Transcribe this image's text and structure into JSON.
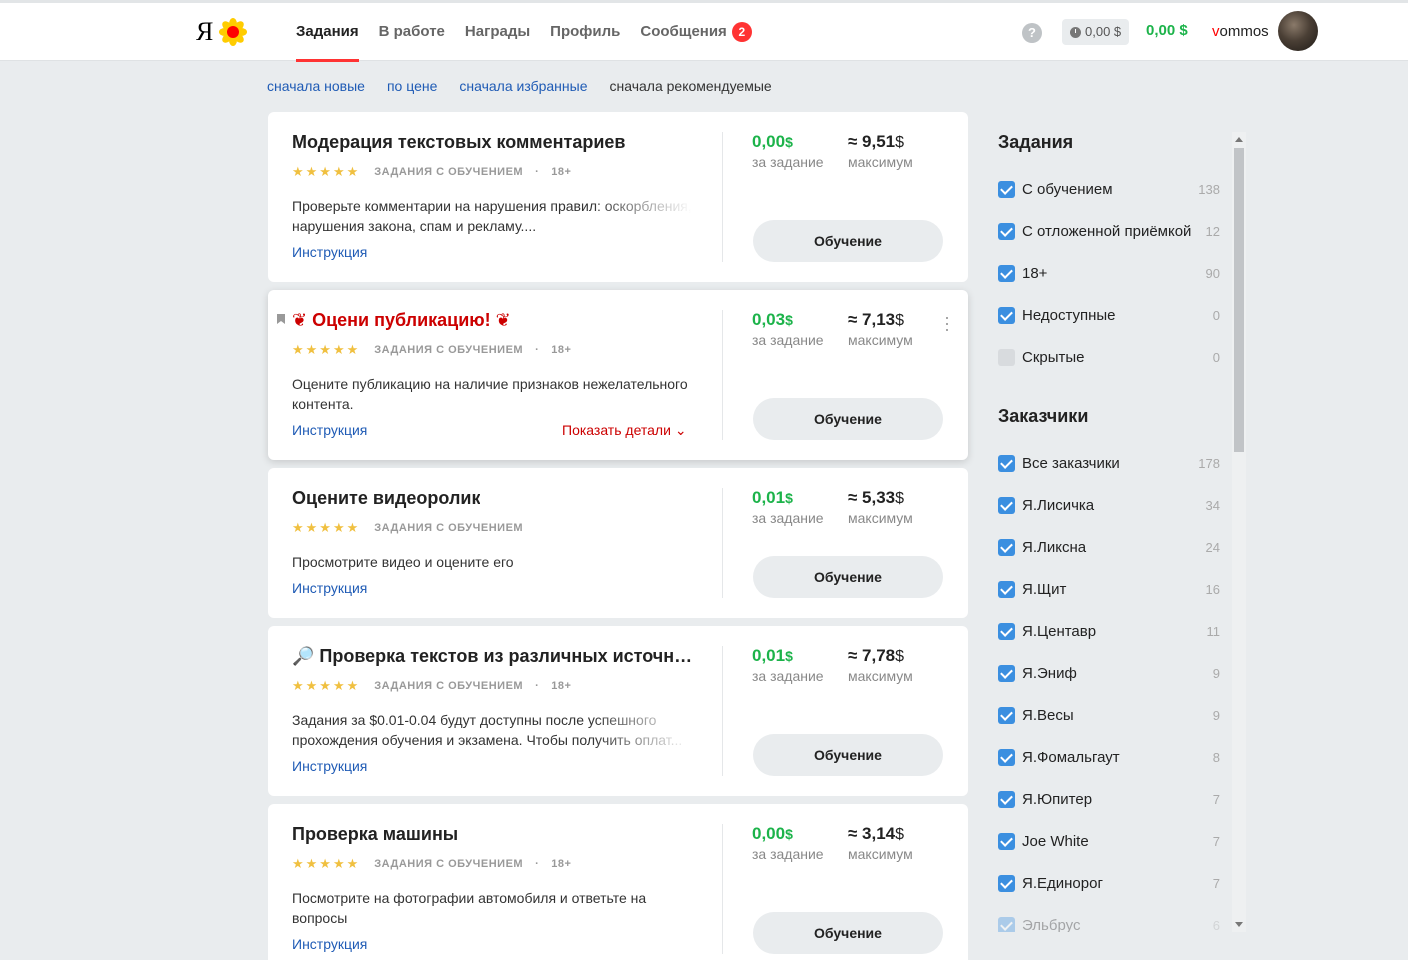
{
  "header": {
    "logo_text": "Я",
    "nav": [
      {
        "label": "Задания",
        "active": true
      },
      {
        "label": "В работе"
      },
      {
        "label": "Награды"
      },
      {
        "label": "Профиль"
      },
      {
        "label": "Сообщения",
        "badge": "2"
      }
    ],
    "help_label": "?",
    "pending_balance": "0,00 $",
    "balance": "0,00 $",
    "username_first": "v",
    "username_rest": "ommos",
    "accent_color": "#ff3333",
    "money_color": "#1cb34a"
  },
  "sort": {
    "items": [
      "сначала новые",
      "по цене",
      "сначала избранные",
      "сначала рекомендуемые"
    ],
    "active": "сначала рекомендуемые"
  },
  "cards": [
    {
      "title": "Модерация текстовых комментариев",
      "stars": "★★★★★",
      "tag": "ЗАДАНИЯ С ОБУЧЕНИЕМ",
      "age": "18+",
      "desc": "Проверьте комментарии на нарушения правил: оскорбления, нарушения закона, спам и рекламу....",
      "instruction": "Инструкция",
      "price": "0,00",
      "price_currency": "$",
      "price_label": "за задание",
      "max": "≈ 9,51",
      "max_currency": "$",
      "max_label": "максимум",
      "button": "Обучение"
    },
    {
      "title": "❦ Оцени публикацию! ❦",
      "stars": "★★★★★",
      "tag": "ЗАДАНИЯ С ОБУЧЕНИЕМ",
      "age": "18+",
      "desc": "Оцените публикацию на наличие признаков нежелательного контента.",
      "instruction": "Инструкция",
      "details": "Показать детали ⌄",
      "price": "0,03",
      "price_currency": "$",
      "price_label": "за задание",
      "max": "≈ 7,13",
      "max_currency": "$",
      "max_label": "максимум",
      "button": "Обучение"
    },
    {
      "title": "Оцените видеоролик",
      "stars": "★★★★★",
      "tag": "ЗАДАНИЯ С ОБУЧЕНИЕМ",
      "desc": "Просмотрите видео и оцените его",
      "instruction": "Инструкция",
      "price": "0,01",
      "price_currency": "$",
      "price_label": "за задание",
      "max": "≈ 5,33",
      "max_currency": "$",
      "max_label": "максимум",
      "button": "Обучение"
    },
    {
      "title": "🔎 Проверка текстов из различных источни...",
      "stars": "★★★★★",
      "tag": "ЗАДАНИЯ С ОБУЧЕНИЕМ",
      "age": "18+",
      "desc": "Задания за $0.01-0.04 будут доступны после успешного прохождения обучения и экзамена. Чтобы получить оплат...",
      "instruction": "Инструкция",
      "price": "0,01",
      "price_currency": "$",
      "price_label": "за задание",
      "max": "≈ 7,78",
      "max_currency": "$",
      "max_label": "максимум",
      "button": "Обучение"
    },
    {
      "title": "Проверка машины",
      "stars": "★★★★★",
      "tag": "ЗАДАНИЯ С ОБУЧЕНИЕМ",
      "age": "18+",
      "desc": "Посмотрите на фотографии автомобиля и ответьте на вопросы",
      "instruction": "Инструкция",
      "price": "0,00",
      "price_currency": "$",
      "price_label": "за задание",
      "max": "≈ 3,14",
      "max_currency": "$",
      "max_label": "максимум",
      "button": "Обучение"
    }
  ],
  "sidebar": {
    "tasks_title": "Задания",
    "tasks": [
      {
        "label": "С обучением",
        "count": "138",
        "checked": true
      },
      {
        "label": "С отложенной приёмкой",
        "count": "12",
        "checked": true
      },
      {
        "label": "18+",
        "count": "90",
        "checked": true
      },
      {
        "label": "Недоступные",
        "count": "0",
        "checked": true
      },
      {
        "label": "Скрытые",
        "count": "0",
        "checked": false
      }
    ],
    "customers_title": "Заказчики",
    "customers": [
      {
        "label": "Все заказчики",
        "count": "178"
      },
      {
        "label": "Я.Лисичка",
        "count": "34"
      },
      {
        "label": "Я.Ликсна",
        "count": "24"
      },
      {
        "label": "Я.Щит",
        "count": "16"
      },
      {
        "label": "Я.Центавр",
        "count": "11"
      },
      {
        "label": "Я.Эниф",
        "count": "9"
      },
      {
        "label": "Я.Весы",
        "count": "9"
      },
      {
        "label": "Я.Фомальгаут",
        "count": "8"
      },
      {
        "label": "Я.Юпитер",
        "count": "7"
      },
      {
        "label": "Joe White",
        "count": "7"
      },
      {
        "label": "Я.Единорог",
        "count": "7"
      },
      {
        "label": "Эльбрус",
        "count": "6"
      }
    ]
  }
}
